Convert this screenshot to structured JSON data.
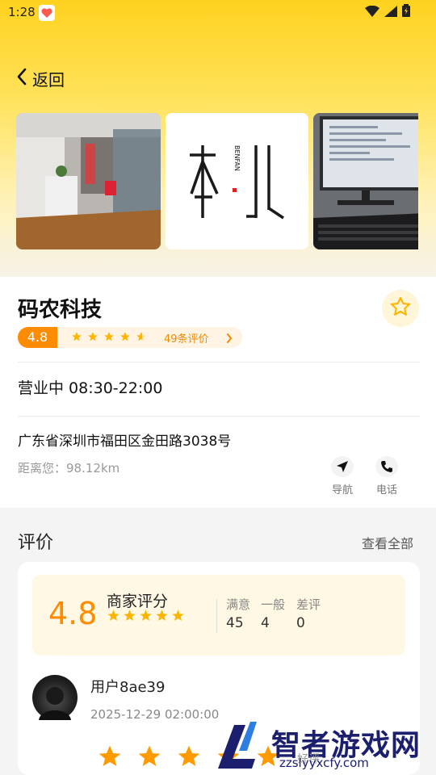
{
  "status_bar": {
    "time": "1:28"
  },
  "header": {
    "back_label": "返回"
  },
  "gallery": {
    "logo_text": "BENFAN"
  },
  "shop": {
    "name": "码农科技",
    "rating": "4.8",
    "star_count": 5,
    "review_count_text": "49条评价",
    "hours": "营业中 08:30-22:00",
    "address": "广东省深圳市福田区金田路3038号",
    "distance": "距离您：98.12km"
  },
  "actions": {
    "navigate_label": "导航",
    "call_label": "电话"
  },
  "reviews": {
    "title": "评价",
    "view_all": "查看全部",
    "summary": {
      "score": "4.8",
      "title": "商家评分",
      "stats": [
        {
          "label": "满意",
          "value": "45"
        },
        {
          "label": "一般",
          "value": "4"
        },
        {
          "label": "差评",
          "value": "0"
        }
      ]
    },
    "first": {
      "user": "用户8ae39",
      "date": "2025-12-29 02:00:00",
      "stars": 5,
      "tag": "好评"
    }
  },
  "watermark": {
    "title": "智者游戏网",
    "url": "zzslyyxcfy.com"
  },
  "colors": {
    "accent": "#ff8c00",
    "star": "#ffb400",
    "brand_yellow": "#ffd21f"
  }
}
